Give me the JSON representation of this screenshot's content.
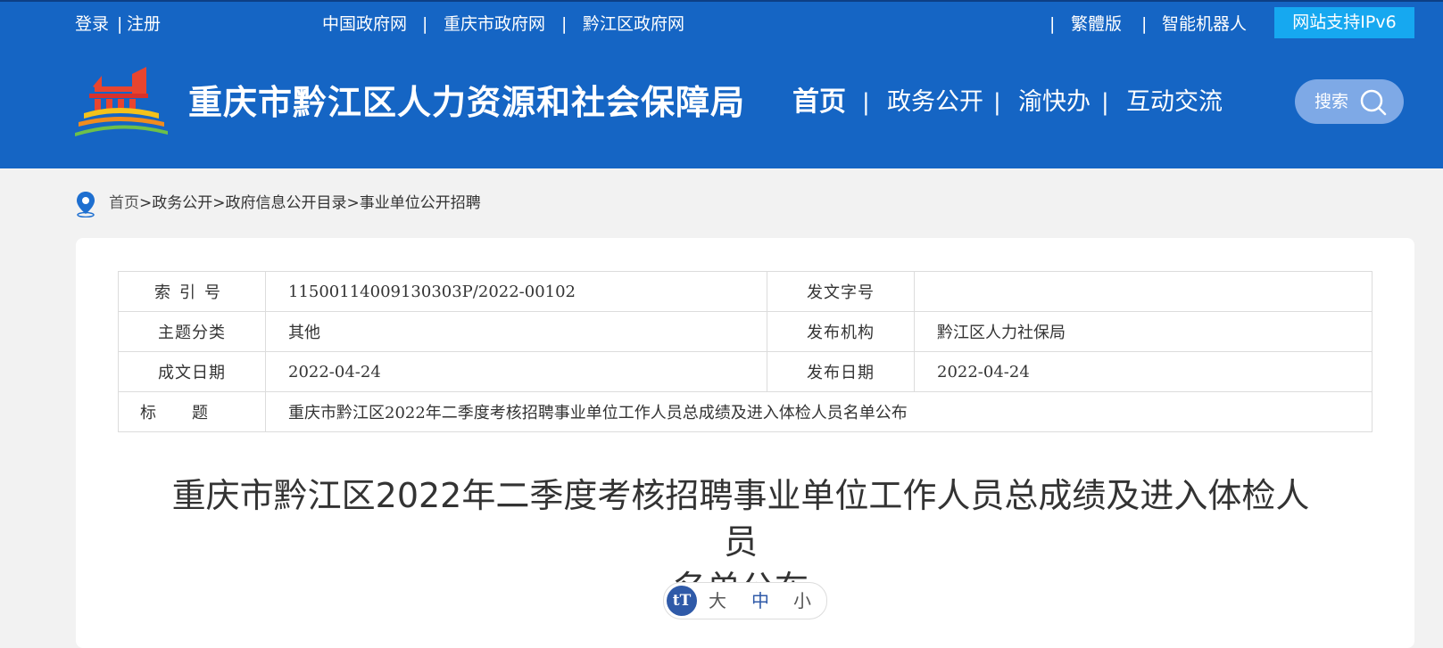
{
  "topbar": {
    "login": "登录",
    "separator": "|",
    "register": "注册",
    "links": [
      "中国政府网",
      "重庆市政府网",
      "黔江区政府网"
    ],
    "right_links": [
      "繁體版",
      "智能机器人"
    ],
    "ipv6_badge": "网站支持IPv6"
  },
  "site": {
    "title": "重庆市黔江区人力资源和社会保障局"
  },
  "nav": {
    "items": [
      "首页",
      "政务公开",
      "渝快办",
      "互动交流"
    ],
    "active": "首页",
    "search_label": "搜索"
  },
  "breadcrumb": {
    "items": [
      "首页",
      "政务公开",
      "政府信息公开目录",
      "事业单位公开招聘"
    ],
    "separator": ">"
  },
  "meta_table": {
    "index_label": "索引号",
    "index_value": "11500114009130303P/2022-00102",
    "doc_no_label": "发文字号",
    "doc_no_value": "",
    "topic_label": "主题分类",
    "topic_value": "其他",
    "publisher_label": "发布机构",
    "publisher_value": "黔江区人力社保局",
    "written_date_label": "成文日期",
    "written_date_value": "2022-04-24",
    "publish_date_label": "发布日期",
    "publish_date_value": "2022-04-24",
    "title_label": "标题",
    "title_value": "重庆市黔江区2022年二季度考核招聘事业单位工作人员总成绩及进入体检人员名单公布"
  },
  "article": {
    "title_line1": "重庆市黔江区2022年二季度考核招聘事业单位工作人员总成绩及进入体检人员",
    "title_line2": "名单公布"
  },
  "font_size_control": {
    "icon_text": "tT",
    "large": "大",
    "medium": "中",
    "small": "小",
    "selected": "中"
  },
  "colors": {
    "header_bg": "#1565c4",
    "ipv6_bg": "#16a8f0",
    "search_bg": "#7ea9e6",
    "page_bg": "#f2f2f2"
  }
}
